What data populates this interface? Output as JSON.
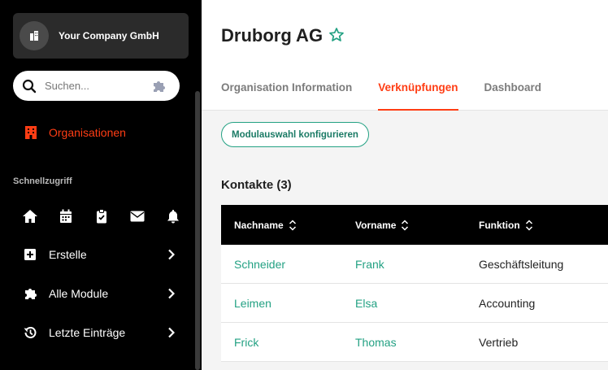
{
  "sidebar": {
    "company_name": "Your Company GmbH",
    "search": {
      "placeholder": "Suchen..."
    },
    "active_nav": "Organisationen",
    "quick_access_title": "Schnellzugriff",
    "menu": [
      {
        "label": "Erstelle",
        "icon": "plus-square-icon"
      },
      {
        "label": "Alle Module",
        "icon": "puzzle-icon"
      },
      {
        "label": "Letzte Einträge",
        "icon": "history-icon"
      }
    ]
  },
  "main": {
    "title": "Druborg AG",
    "tabs": [
      {
        "label": "Organisation Information",
        "active": false
      },
      {
        "label": "Verknüpfungen",
        "active": true
      },
      {
        "label": "Dashboard",
        "active": false
      }
    ],
    "config_button": "Modulauswahl konfigurieren",
    "contacts": {
      "title": "Kontakte (3)",
      "columns": [
        "Nachname",
        "Vorname",
        "Funktion"
      ],
      "rows": [
        {
          "nachname": "Schneider",
          "vorname": "Frank",
          "funktion": "Geschäftsleitung"
        },
        {
          "nachname": "Leimen",
          "vorname": "Elsa",
          "funktion": "Accounting"
        },
        {
          "nachname": "Frick",
          "vorname": "Thomas",
          "funktion": "Vertrieb"
        }
      ]
    }
  },
  "colors": {
    "accent": "#ff3d14",
    "link": "#23a183",
    "sidebar_bg": "#000000"
  }
}
